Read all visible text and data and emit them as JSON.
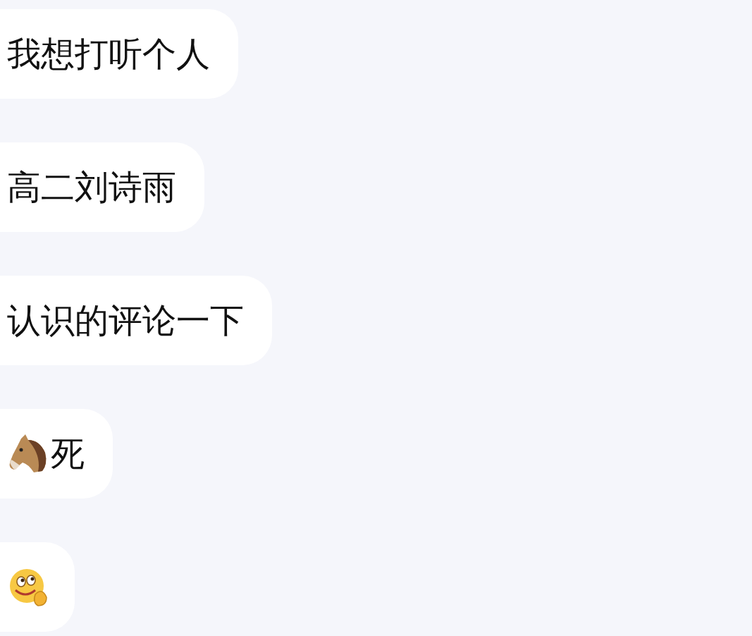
{
  "messages": [
    {
      "kind": "text",
      "text": "我想打听个人"
    },
    {
      "kind": "text",
      "text": "高二刘诗雨"
    },
    {
      "kind": "text",
      "text": "认识的评论一下"
    },
    {
      "kind": "horse_text",
      "text": "死"
    },
    {
      "kind": "sticker"
    }
  ]
}
